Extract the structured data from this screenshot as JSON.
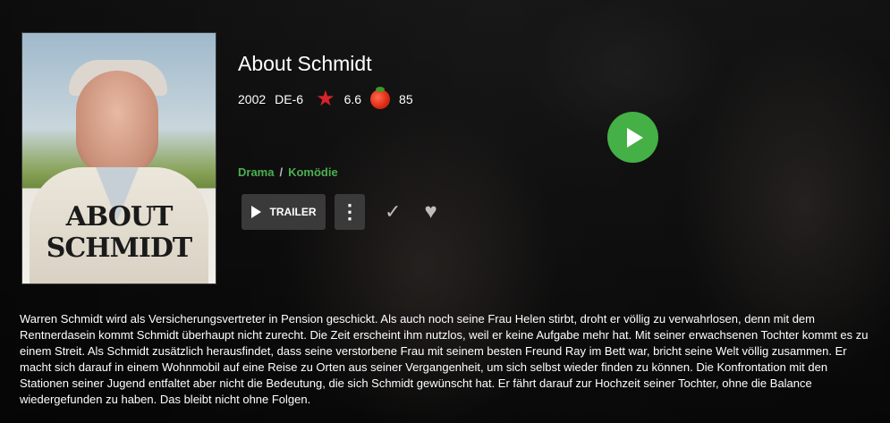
{
  "movie": {
    "title": "About Schmidt",
    "poster_title": "ABOUT SCHMIDT",
    "year": "2002",
    "age_rating": "DE-6",
    "rating": "6.6",
    "tomato_score": "85",
    "genres": [
      "Drama",
      "Komödie"
    ],
    "genre_separator": "/",
    "description": "Warren Schmidt wird als Versicherungsvertreter in Pension geschickt. Als auch noch seine Frau Helen stirbt, droht er völlig zu verwahrlosen, denn mit dem Rentnerdasein kommt Schmidt überhaupt nicht zurecht. Die Zeit erscheint ihm nutzlos, weil er keine Aufgabe mehr hat. Mit seiner erwachsenen Tochter kommt es zu einem Streit. Als Schmidt zusätzlich herausfindet, dass seine verstorbene Frau mit seinem besten Freund Ray im Bett war, bricht seine Welt völlig zusammen. Er macht sich darauf in einem Wohnmobil auf eine Reise zu Orten aus seiner Vergangenheit, um sich selbst wieder finden zu können. Die Konfrontation mit den Stationen seiner Jugend entfaltet aber nicht die Bedeutung, die sich Schmidt gewünscht hat. Er fährt darauf zur Hochzeit seiner Tochter, ohne die Balance wiedergefunden zu haben. Das bleibt nicht ohne Folgen."
  },
  "actions": {
    "trailer_label": "TRAILER",
    "more_icon": "⋮",
    "check_icon": "✓",
    "heart_icon": "♥",
    "star_icon": "★"
  },
  "colors": {
    "accent_green": "#44b045",
    "genre_green": "#4caf50",
    "rating_star": "#d8232a"
  }
}
